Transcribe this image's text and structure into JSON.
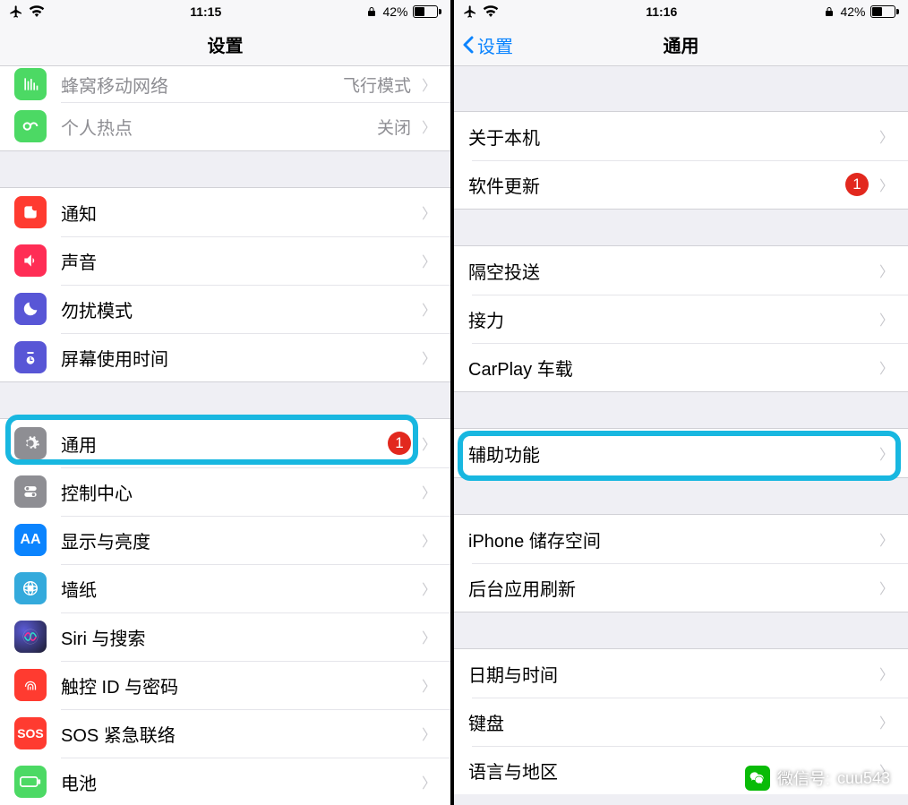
{
  "left": {
    "status": {
      "time": "11:15",
      "battery_pct": "42%"
    },
    "nav": {
      "title": "设置"
    },
    "network": {
      "cellular": {
        "label": "蜂窝移动网络",
        "value": "飞行模式"
      },
      "hotspot": {
        "label": "个人热点",
        "value": "关闭"
      }
    },
    "section2": {
      "notifications": "通知",
      "sounds": "声音",
      "dnd": "勿扰模式",
      "screentime": "屏幕使用时间"
    },
    "section3": {
      "general": {
        "label": "通用",
        "badge": "1"
      },
      "control": "控制中心",
      "display": "显示与亮度",
      "wallpaper": "墙纸",
      "siri": "Siri 与搜索",
      "touchid": "触控 ID 与密码",
      "sos": "SOS 紧急联络",
      "battery": "电池"
    }
  },
  "right": {
    "status": {
      "time": "11:16",
      "battery_pct": "42%"
    },
    "nav": {
      "back": "设置",
      "title": "通用"
    },
    "s1": {
      "about": "关于本机",
      "update": {
        "label": "软件更新",
        "badge": "1"
      }
    },
    "s2": {
      "airdrop": "隔空投送",
      "handoff": "接力",
      "carplay": "CarPlay 车载"
    },
    "s3": {
      "access": "辅助功能"
    },
    "s4": {
      "storage": "iPhone 储存空间",
      "bgrefresh": "后台应用刷新"
    },
    "s5": {
      "datetime": "日期与时间",
      "keyboard": "键盘",
      "lang": "语言与地区"
    }
  },
  "watermark": {
    "prefix": "微信号:",
    "id": "cuu543"
  }
}
